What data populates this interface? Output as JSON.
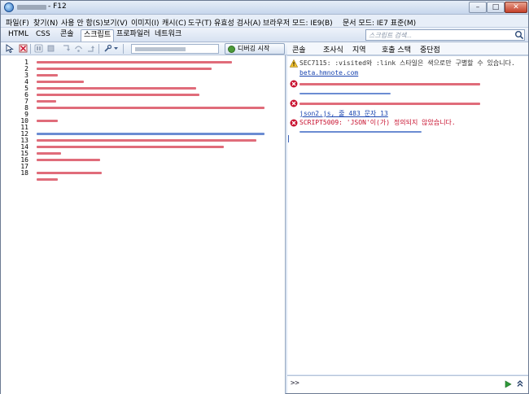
{
  "window": {
    "title": "- F12",
    "min_label": "–",
    "max_label": "□",
    "close_label": "✕"
  },
  "menu": [
    {
      "label": "파일(F)"
    },
    {
      "label": "찾기(N)"
    },
    {
      "label": "사용 안 함(S)"
    },
    {
      "label": "보기(V)"
    },
    {
      "label": "이미지(I)"
    },
    {
      "label": "캐시(C)"
    },
    {
      "label": "도구(T)"
    },
    {
      "label": "유효성 검사(A)"
    },
    {
      "label": "브라우저 모드: IE9(B)"
    },
    {
      "label": "문서 모드: IE7 표준(M)"
    }
  ],
  "tabs": [
    {
      "label": "HTML"
    },
    {
      "label": "CSS"
    },
    {
      "label": "콘솔"
    },
    {
      "label": "스크립트"
    },
    {
      "label": "프로파일러"
    },
    {
      "label": "네트워크"
    }
  ],
  "search": {
    "placeholder": "스크립트 검색..."
  },
  "toolbar": {
    "debug_label": "디버깅 시작"
  },
  "right_tabs": [
    {
      "label": "콘솔"
    },
    {
      "label": "조사식"
    },
    {
      "label": "지역"
    },
    {
      "label": "호출 스택"
    },
    {
      "label": "중단점"
    }
  ],
  "line_numbers": [
    "1",
    "2",
    "3",
    "4",
    "5",
    "6",
    "7",
    "8",
    "9",
    "10",
    "11",
    "12",
    "13",
    "14",
    "15",
    "16",
    "17",
    "18"
  ],
  "console": {
    "messages": [
      {
        "type": "warning",
        "text": "SEC7115: :visited와 :link 스타일은 색으로만 구별할 수 있습니다.",
        "link": "beta.hmnote.com"
      },
      {
        "type": "error",
        "text": "",
        "link": ""
      },
      {
        "type": "error",
        "text": "",
        "link": "json2.js, 줄 483 문자 13"
      },
      {
        "type": "error",
        "text": "SCRIPT5009: 'JSON'이(가) 정의되지 않았습니다.",
        "link": ""
      }
    ],
    "prompt": ">>"
  },
  "colors": {
    "error": "#c8102e",
    "warning": "#e2a400",
    "link": "#1a45b0",
    "code_red": "#e06c7a",
    "code_blue": "#6b8cd2"
  }
}
